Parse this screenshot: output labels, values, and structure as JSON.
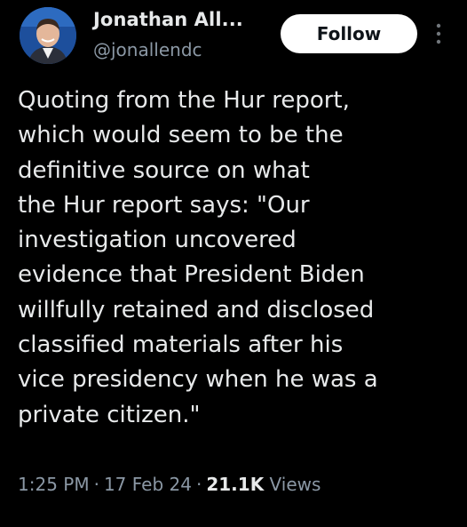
{
  "author": {
    "display_name": "Jonathan All...",
    "handle": "@jonallendc"
  },
  "follow_label": "Follow",
  "more_icon": "more-vertical-icon",
  "tweet": {
    "text": "Quoting from the Hur report,\nwhich would seem to be the\ndefinitive source on what\nthe Hur report says: \"Our\ninvestigation uncovered\nevidence that President Biden\nwillfully retained and disclosed\nclassified materials after his\nvice presidency when he was a\nprivate citizen.\""
  },
  "meta": {
    "time": "1:25 PM",
    "separator": "·",
    "date": "17 Feb 24",
    "views_count": "21.1K",
    "views_label": "Views"
  },
  "colors": {
    "background": "#000000",
    "text_primary": "#e7e9ea",
    "text_secondary": "#8b98a5",
    "follow_bg": "#ffffff"
  }
}
